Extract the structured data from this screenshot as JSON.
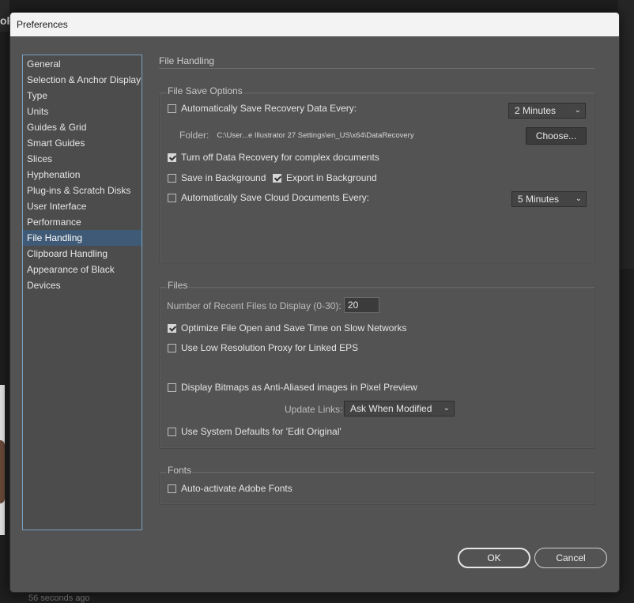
{
  "background": {
    "top_left_fragment": "oF",
    "bottom_status": "56 seconds ago"
  },
  "dialog": {
    "title": "Preferences"
  },
  "sidebar": {
    "items": [
      {
        "label": "General"
      },
      {
        "label": "Selection & Anchor Display"
      },
      {
        "label": "Type"
      },
      {
        "label": "Units"
      },
      {
        "label": "Guides & Grid"
      },
      {
        "label": "Smart Guides"
      },
      {
        "label": "Slices"
      },
      {
        "label": "Hyphenation"
      },
      {
        "label": "Plug-ins & Scratch Disks"
      },
      {
        "label": "User Interface"
      },
      {
        "label": "Performance"
      },
      {
        "label": "File Handling"
      },
      {
        "label": "Clipboard Handling"
      },
      {
        "label": "Appearance of Black"
      },
      {
        "label": "Devices"
      }
    ],
    "active_index": 11
  },
  "page": {
    "title": "File Handling"
  },
  "file_save_options": {
    "title": "File Save Options",
    "auto_save_label": "Automatically Save Recovery Data Every:",
    "auto_save_checked": false,
    "auto_save_interval": "2 Minutes",
    "folder_label": "Folder:",
    "folder_path": "C:\\User...e Illustrator 27 Settings\\en_US\\x64\\DataRecovery",
    "choose_label": "Choose...",
    "turn_off_recovery_label": "Turn off Data Recovery for complex documents",
    "turn_off_recovery_checked": true,
    "save_background_label": "Save in Background",
    "save_background_checked": false,
    "export_background_label": "Export in Background",
    "export_background_checked": true,
    "auto_save_cloud_label": "Automatically Save Cloud Documents Every:",
    "auto_save_cloud_checked": false,
    "auto_save_cloud_interval": "5 Minutes"
  },
  "files": {
    "title": "Files",
    "recent_files_label": "Number of Recent Files to Display (0-30):",
    "recent_files_value": "20",
    "optimize_label": "Optimize File Open and Save Time on Slow Networks",
    "optimize_checked": true,
    "low_res_label": "Use Low Resolution Proxy for Linked EPS",
    "low_res_checked": false,
    "anti_alias_label": "Display Bitmaps as Anti-Aliased images in Pixel Preview",
    "anti_alias_checked": false,
    "update_links_label": "Update Links:",
    "update_links_value": "Ask When Modified",
    "system_defaults_label": "Use System Defaults for 'Edit Original'",
    "system_defaults_checked": false
  },
  "fonts": {
    "title": "Fonts",
    "auto_activate_label": "Auto-activate Adobe Fonts",
    "auto_activate_checked": false
  },
  "footer": {
    "ok_label": "OK",
    "cancel_label": "Cancel"
  }
}
